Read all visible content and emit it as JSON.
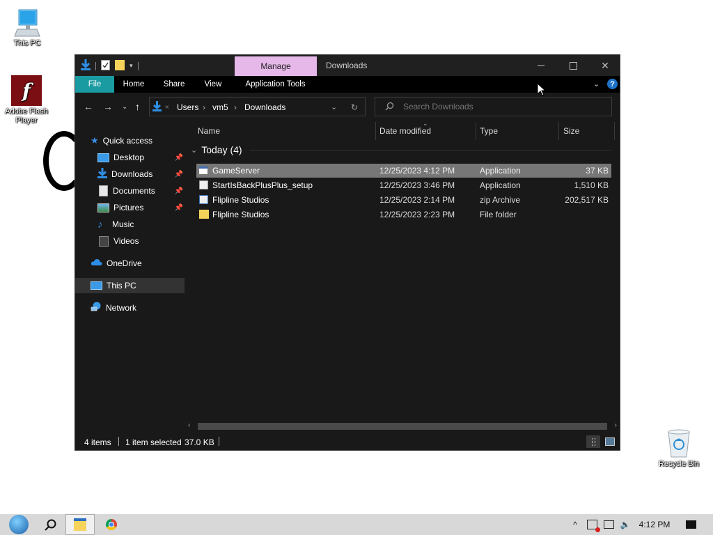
{
  "desktop": {
    "icons": [
      {
        "label": "This PC",
        "icon": "computer-icon"
      },
      {
        "label": "Adobe Flash Player",
        "icon": "flash-player-icon"
      },
      {
        "label": "Recycle Bin",
        "icon": "recycle-bin-icon"
      }
    ]
  },
  "window": {
    "title": "Downloads",
    "manage_tab": "Manage",
    "ribbon_tabs": [
      "File",
      "Home",
      "Share",
      "View",
      "Application Tools"
    ],
    "breadcrumbs": [
      "Users",
      "vm5",
      "Downloads"
    ],
    "breadcrumb_overflow": "«",
    "search_placeholder": "Search Downloads"
  },
  "nav_pane": {
    "quick_access": "Quick access",
    "items": [
      {
        "label": "Desktop",
        "icon": "desktop-folder-icon",
        "pinned": true
      },
      {
        "label": "Downloads",
        "icon": "downloads-folder-icon",
        "pinned": true
      },
      {
        "label": "Documents",
        "icon": "documents-folder-icon",
        "pinned": true
      },
      {
        "label": "Pictures",
        "icon": "pictures-folder-icon",
        "pinned": true
      },
      {
        "label": "Music",
        "icon": "music-folder-icon",
        "pinned": false
      },
      {
        "label": "Videos",
        "icon": "videos-folder-icon",
        "pinned": false
      }
    ],
    "onedrive": "OneDrive",
    "this_pc": "This PC",
    "network": "Network"
  },
  "file_list": {
    "columns": [
      "Name",
      "Date modified",
      "Type",
      "Size"
    ],
    "group": "Today (4)",
    "rows": [
      {
        "name": "GameServer",
        "date": "12/25/2023 4:12 PM",
        "type": "Application",
        "size": "37 KB",
        "icon": "application-icon"
      },
      {
        "name": "StartIsBackPlusPlus_setup",
        "date": "12/25/2023 3:46 PM",
        "type": "Application",
        "size": "1,510 KB",
        "icon": "installer-icon"
      },
      {
        "name": "Flipline Studios",
        "date": "12/25/2023 2:14 PM",
        "type": "zip Archive",
        "size": "202,517 KB",
        "icon": "zip-archive-icon"
      },
      {
        "name": "Flipline Studios",
        "date": "12/25/2023 2:23 PM",
        "type": "File folder",
        "size": "",
        "icon": "folder-icon"
      }
    ]
  },
  "status": {
    "items": "4 items",
    "selected": "1 item selected",
    "size": "37.0 KB"
  },
  "taskbar": {
    "clock": "4:12 PM"
  },
  "colors": {
    "file_tab": "#1a9ba1",
    "manage_tab": "#e6b8ea",
    "window_bg": "#191919",
    "selection": "#777777"
  }
}
